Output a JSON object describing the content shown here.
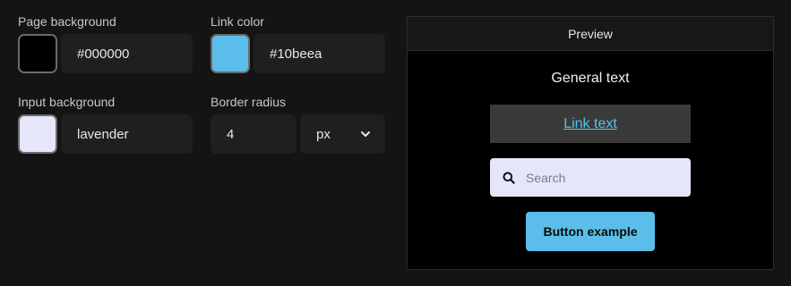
{
  "settings": {
    "page_background": {
      "label": "Page background",
      "value": "#000000",
      "swatch_color": "#000000"
    },
    "link_color": {
      "label": "Link color",
      "value": "#10beea",
      "swatch_color": "#5bbeea"
    },
    "input_background": {
      "label": "Input background",
      "value": "lavender",
      "swatch_color": "#e6e6fa"
    },
    "border_radius": {
      "label": "Border radius",
      "value": "4",
      "unit": "px"
    }
  },
  "preview": {
    "title": "Preview",
    "general_text": "General text",
    "link_text": "Link text",
    "search_placeholder": "Search",
    "button_label": "Button example"
  },
  "icons": {
    "search": "search-icon",
    "unit_dropdown": "chevron-down-icon"
  }
}
